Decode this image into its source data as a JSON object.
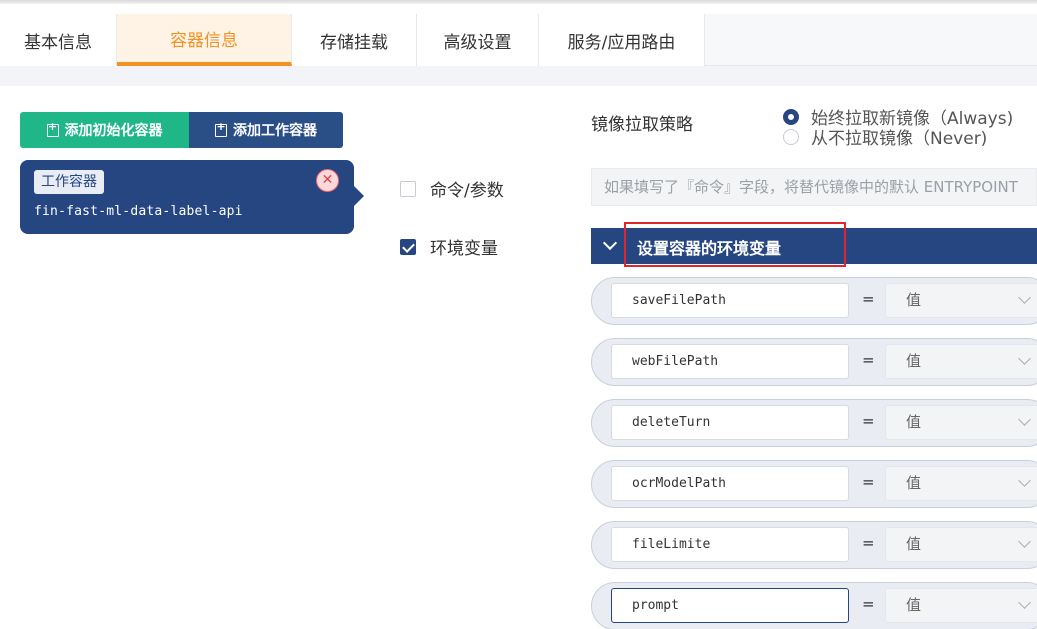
{
  "tabs": [
    {
      "label": "基本信息"
    },
    {
      "label": "容器信息"
    },
    {
      "label": "存储挂载"
    },
    {
      "label": "高级设置"
    },
    {
      "label": "服务/应用路由"
    }
  ],
  "active_tab": "容器信息",
  "buttons": {
    "add_init_container": "添加初始化容器",
    "add_work_container": "添加工作容器"
  },
  "container_card": {
    "badge": "工作容器",
    "name": "fin-fast-ml-data-label-api"
  },
  "options": {
    "command_args": {
      "label": "命令/参数",
      "checked": false
    },
    "env_vars": {
      "label": "环境变量",
      "checked": true
    }
  },
  "pull_policy": {
    "label": "镜像拉取策略",
    "choices": [
      {
        "label": "始终拉取新镜像（Always)",
        "selected": true
      },
      {
        "label": "从不拉取镜像（Never)",
        "selected": false
      }
    ]
  },
  "command_placeholder": "如果填写了『命令』字段，将替代镜像中的默认 ENTRYPOINT",
  "env_section": {
    "title": "设置容器的环境变量",
    "equals": "=",
    "value_placeholder": "值",
    "rows": [
      {
        "key": "saveFilePath"
      },
      {
        "key": "webFilePath"
      },
      {
        "key": "deleteTurn"
      },
      {
        "key": "ocrModelPath"
      },
      {
        "key": "fileLimite"
      },
      {
        "key": "prompt"
      }
    ]
  },
  "colors": {
    "accent_orange": "#f39224",
    "primary_blue": "#264682",
    "green": "#1fb787",
    "highlight_red": "#e0262c"
  }
}
